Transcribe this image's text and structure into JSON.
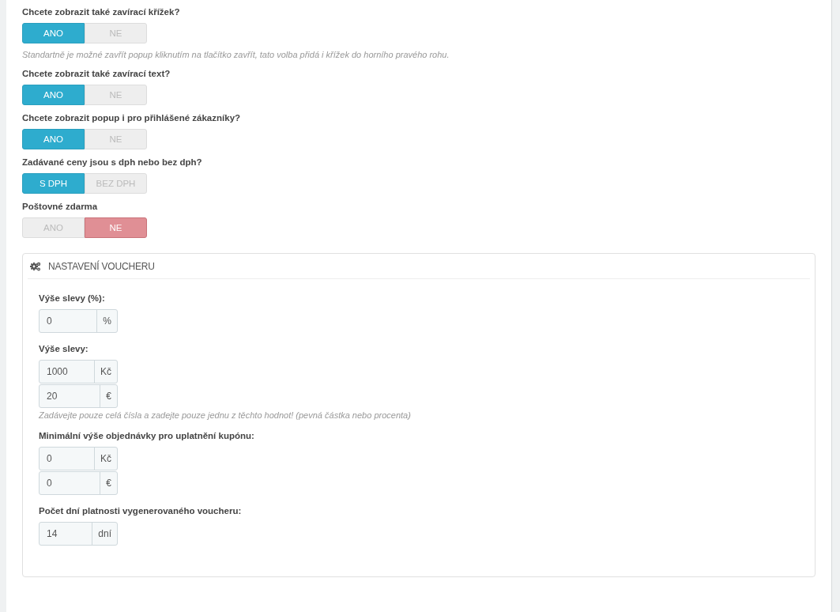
{
  "settings": [
    {
      "question": "Chcete zobrazit také zavírací křížek?",
      "options": [
        {
          "label": "ANO",
          "selected": true
        },
        {
          "label": "NE",
          "selected": false
        }
      ],
      "help": "Standartně je možné zavřít popup kliknutím na tlačítko zavřít, tato volba přidá i křížek do horního pravého rohu."
    },
    {
      "question": "Chcete zobrazit také zavírací text?",
      "options": [
        {
          "label": "ANO",
          "selected": true
        },
        {
          "label": "NE",
          "selected": false
        }
      ]
    },
    {
      "question": "Chcete zobrazit popup i pro přihlášené zákazníky?",
      "options": [
        {
          "label": "ANO",
          "selected": true
        },
        {
          "label": "NE",
          "selected": false
        }
      ]
    },
    {
      "question": "Zadávané ceny jsou s dph nebo bez dph?",
      "options": [
        {
          "label": "S DPH",
          "selected": true
        },
        {
          "label": "BEZ DPH",
          "selected": false
        }
      ]
    },
    {
      "question": "Poštovné zdarma",
      "options": [
        {
          "label": "ANO",
          "selected": false
        },
        {
          "label": "NE",
          "selected": true
        }
      ]
    }
  ],
  "voucher_panel": {
    "title": "NASTAVENÍ VOUCHERU",
    "groups": [
      {
        "label": "Výše slevy (%):",
        "inputs": [
          {
            "value": "0",
            "unit": "%"
          }
        ]
      },
      {
        "label": "Výše slevy:",
        "inputs": [
          {
            "value": "1000",
            "unit": "Kč"
          },
          {
            "value": "20",
            "unit": "€"
          }
        ],
        "help": "Zadávejte pouze celá čísla a zadejte pouze jednu z těchto hodnot! (pevná částka nebo procenta)"
      },
      {
        "label": "Minimální výše objednávky pro uplatnění kupónu:",
        "inputs": [
          {
            "value": "0",
            "unit": "Kč"
          },
          {
            "value": "0",
            "unit": "€"
          }
        ]
      },
      {
        "label": "Počet dní platnosti vygenerovaného voucheru:",
        "inputs": [
          {
            "value": "14",
            "unit": "dní"
          }
        ]
      }
    ]
  }
}
